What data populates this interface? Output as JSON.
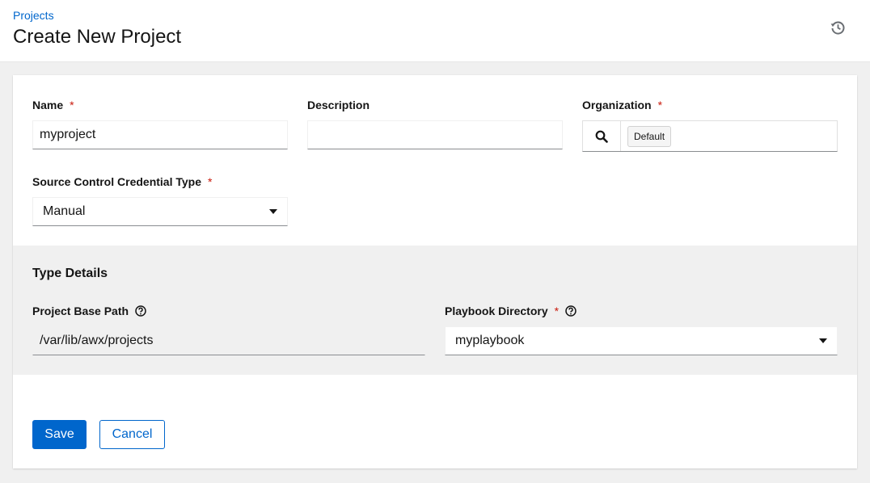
{
  "breadcrumb": {
    "parent": "Projects"
  },
  "page": {
    "title": "Create New Project"
  },
  "form": {
    "name": {
      "label": "Name",
      "required": "*",
      "value": "myproject"
    },
    "description": {
      "label": "Description",
      "value": ""
    },
    "organization": {
      "label": "Organization",
      "required": "*",
      "chip": "Default"
    },
    "scm_type": {
      "label": "Source Control Credential Type",
      "required": "*",
      "value": "Manual"
    }
  },
  "type_details": {
    "title": "Type Details",
    "base_path": {
      "label": "Project Base Path",
      "value": "/var/lib/awx/projects"
    },
    "playbook_dir": {
      "label": "Playbook Directory",
      "required": "*",
      "value": "myplaybook"
    }
  },
  "actions": {
    "save": "Save",
    "cancel": "Cancel"
  },
  "icons": {
    "history": "history-icon",
    "search": "search-icon",
    "help": "question-circle-icon",
    "caret": "caret-down-icon"
  },
  "colors": {
    "primary": "#0066cc",
    "required": "#c9190b"
  }
}
